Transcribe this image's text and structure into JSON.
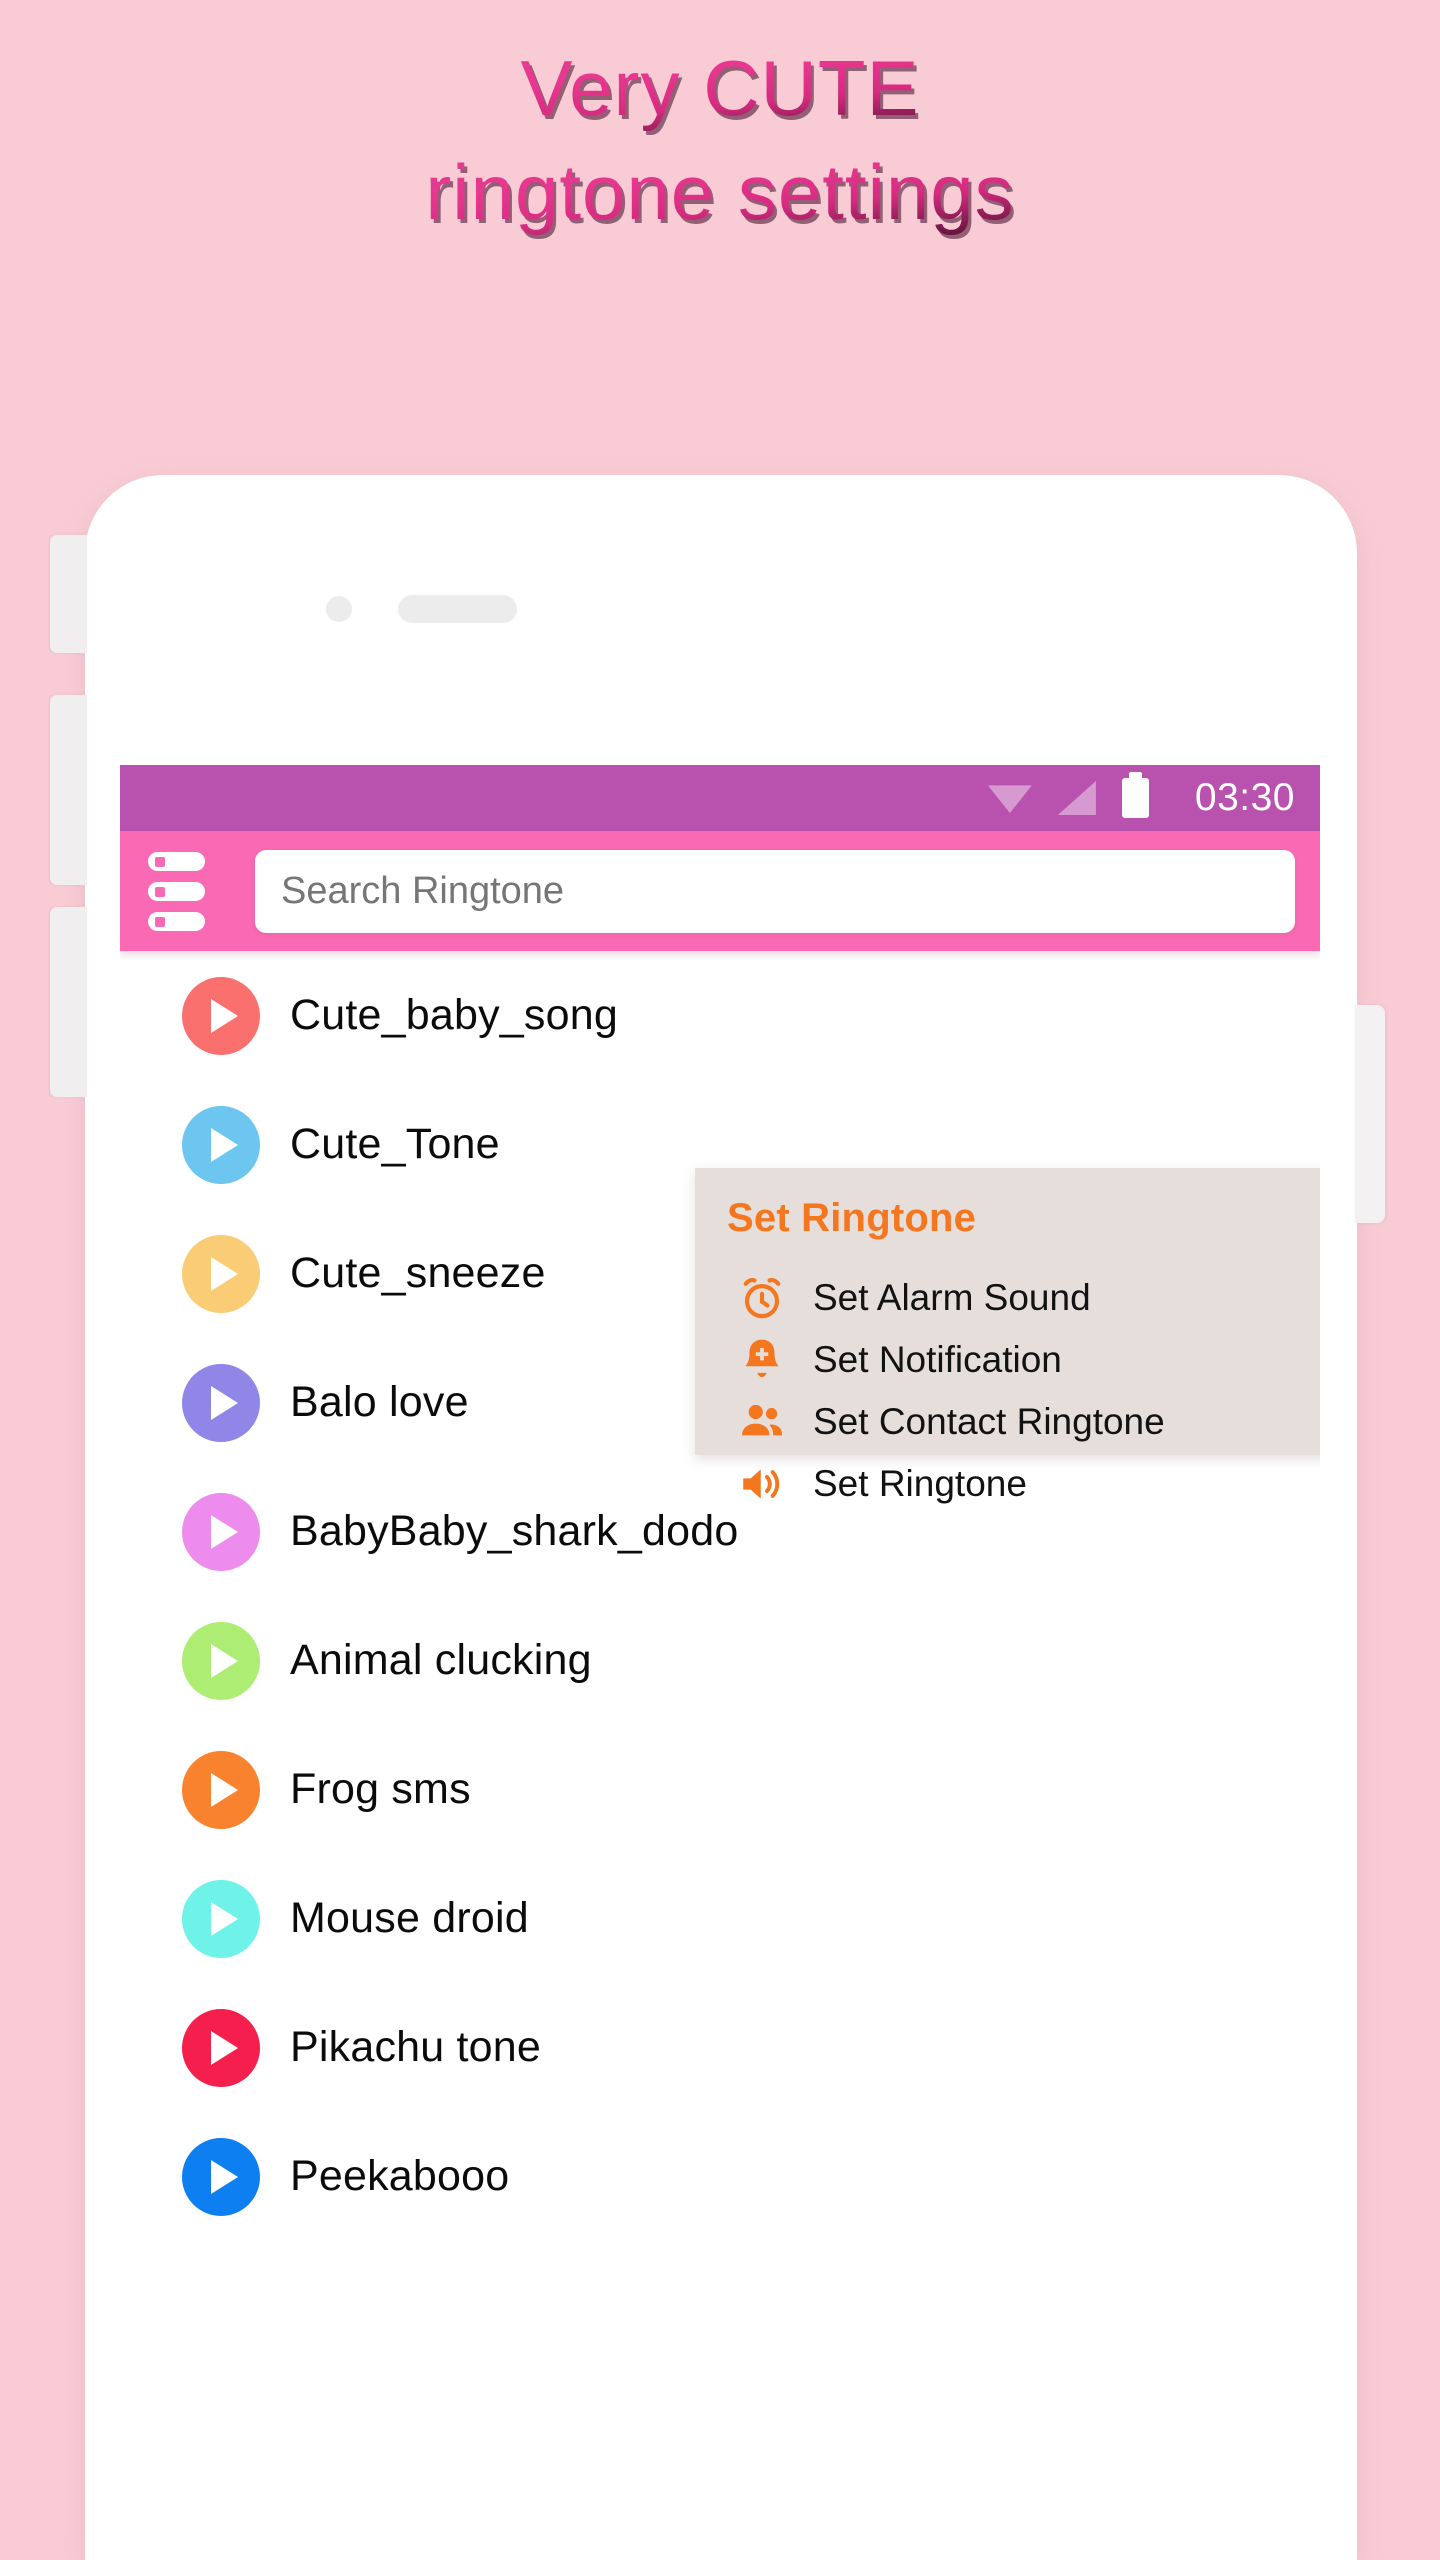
{
  "promo": {
    "line1": "Very CUTE",
    "line2": "ringtone settings",
    "text_color": "#e0408f",
    "background": "#f9ccd5"
  },
  "phone": {
    "camera_icon": "camera-dot-icon",
    "speaker_icon": "earpiece-speaker-icon",
    "side_buttons": [
      "volume-up",
      "volume-down",
      "silent-switch",
      "power"
    ]
  },
  "statusbar": {
    "background": "#b852ae",
    "wifi_icon": "wifi-icon",
    "signal_icon": "cellular-signal-icon",
    "battery_icon": "battery-full-icon",
    "time": "03:30"
  },
  "header": {
    "background": "#fa69b3",
    "menu_icon": "hamburger-menu-icon",
    "search_placeholder": "Search Ringtone",
    "search_value": ""
  },
  "ringtones": [
    {
      "label": "Cute_baby_song",
      "color": "#f9706e",
      "icon": "play-icon"
    },
    {
      "label": "Cute_Tone",
      "color": "#6dc6f0",
      "icon": "play-icon"
    },
    {
      "label": "Cute_sneeze",
      "color": "#fbcc76",
      "icon": "play-icon"
    },
    {
      "label": "Balo love",
      "color": "#8f86e8",
      "icon": "play-icon"
    },
    {
      "label": "BabyBaby_shark_dodo",
      "color": "#ee8cee",
      "icon": "play-icon"
    },
    {
      "label": "Animal clucking",
      "color": "#aeed73",
      "icon": "play-icon"
    },
    {
      "label": "Frog sms",
      "color": "#f8822e",
      "icon": "play-icon"
    },
    {
      "label": "Mouse droid",
      "color": "#6ff2e8",
      "icon": "play-icon"
    },
    {
      "label": "Pikachu tone",
      "color": "#f41f4d",
      "icon": "play-icon"
    },
    {
      "label": "Peekabooo",
      "color": "#0d7ff0",
      "icon": "play-icon"
    }
  ],
  "dialog": {
    "title": "Set Ringtone",
    "title_color": "#f4761e",
    "background": "#e5dedb",
    "items": [
      {
        "label": "Set Alarm Sound",
        "icon": "alarm-clock-icon"
      },
      {
        "label": "Set Notification",
        "icon": "bell-plus-icon"
      },
      {
        "label": "Set Contact Ringtone",
        "icon": "people-icon"
      },
      {
        "label": "Set Ringtone",
        "icon": "speaker-volume-icon"
      }
    ]
  }
}
